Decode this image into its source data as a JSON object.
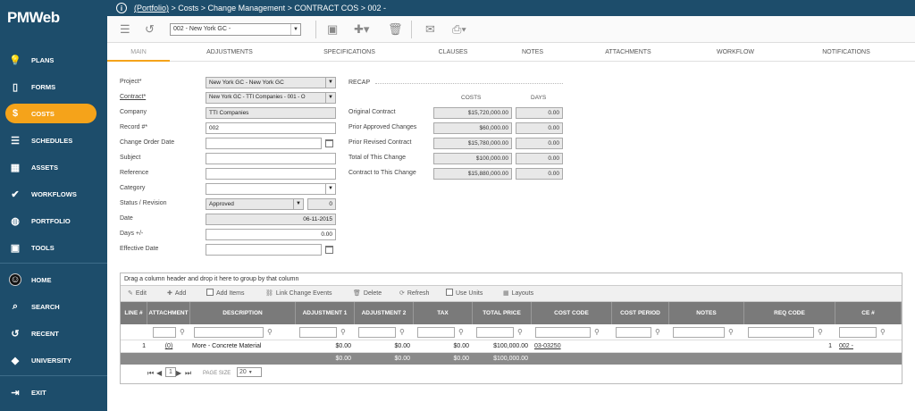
{
  "app": {
    "logo_text": "PMWeb"
  },
  "breadcrumb": {
    "root": "(Portfolio)",
    "rest": "> Costs > Change Management > CONTRACT COS > 002 -"
  },
  "toolbar": {
    "record_select_value": "002 - New York GC -"
  },
  "sidebar": {
    "items": [
      {
        "label": "PLANS",
        "icon": "lightbulb-icon"
      },
      {
        "label": "FORMS",
        "icon": "document-icon"
      },
      {
        "label": "COSTS",
        "icon": "dollar-icon"
      },
      {
        "label": "SCHEDULES",
        "icon": "schedule-icon"
      },
      {
        "label": "ASSETS",
        "icon": "building-icon"
      },
      {
        "label": "WORKFLOWS",
        "icon": "check-icon"
      },
      {
        "label": "PORTFOLIO",
        "icon": "globe-icon"
      },
      {
        "label": "TOOLS",
        "icon": "briefcase-icon"
      },
      {
        "label": "HOME",
        "icon": "avatar-icon"
      },
      {
        "label": "SEARCH",
        "icon": "search-icon"
      },
      {
        "label": "RECENT",
        "icon": "history-icon"
      },
      {
        "label": "UNIVERSITY",
        "icon": "graduation-cap-icon"
      },
      {
        "label": "EXIT",
        "icon": "exit-icon"
      }
    ]
  },
  "tabs": [
    "MAIN",
    "ADJUSTMENTS",
    "SPECIFICATIONS",
    "CLAUSES",
    "NOTES",
    "ATTACHMENTS",
    "WORKFLOW",
    "NOTIFICATIONS"
  ],
  "form": {
    "project": {
      "label": "Project*",
      "value": "New York GC - New York GC"
    },
    "contract": {
      "label": "Contract*",
      "value": "New York GC - TTI Companies - 001 - O"
    },
    "company": {
      "label": "Company",
      "value": "TTI Companies"
    },
    "record": {
      "label": "Record #*",
      "value": "002"
    },
    "change_order_date": {
      "label": "Change Order Date",
      "value": ""
    },
    "subject": {
      "label": "Subject",
      "value": ""
    },
    "reference": {
      "label": "Reference",
      "value": ""
    },
    "category": {
      "label": "Category",
      "value": ""
    },
    "status": {
      "label": "Status / Revision",
      "value": "Approved",
      "revision": "0"
    },
    "date": {
      "label": "Date",
      "value": "06-11-2015"
    },
    "days": {
      "label": "Days +/-",
      "value": "0.00"
    },
    "effective_date": {
      "label": "Effective Date",
      "value": ""
    }
  },
  "recap": {
    "title": "RECAP",
    "costs_header": "COSTS",
    "days_header": "DAYS",
    "rows": [
      {
        "label": "Original Contract",
        "cost": "$15,720,000.00",
        "days": "0.00"
      },
      {
        "label": "Prior Approved Changes",
        "cost": "$60,000.00",
        "days": "0.00"
      },
      {
        "label": "Prior Revised Contract",
        "cost": "$15,780,000.00",
        "days": "0.00"
      },
      {
        "label": "Total of This Change",
        "cost": "$100,000.00",
        "days": "0.00"
      },
      {
        "label": "Contract to This Change",
        "cost": "$15,880,000.00",
        "days": "0.00"
      }
    ]
  },
  "grid": {
    "group_hint": "Drag a column header and drop it here to group by that column",
    "toolbar": {
      "edit": "Edit",
      "add": "Add",
      "add_items": "Add Items",
      "link": "Link Change Events",
      "delete": "Delete",
      "refresh": "Refresh",
      "use_units": "Use Units",
      "layouts": "Layouts"
    },
    "columns": [
      "LINE #",
      "ATTACHMENT",
      "DESCRIPTION",
      "ADJUSTMENT 1",
      "ADJUSTMENT 2",
      "TAX",
      "TOTAL PRICE",
      "COST CODE",
      "COST PERIOD",
      "NOTES",
      "REQ CODE",
      "CE #"
    ],
    "row": {
      "line": "1",
      "attachment": "(0)",
      "description": "More - Concrete Material",
      "adj1": "$0.00",
      "adj2": "$0.00",
      "tax": "$0.00",
      "total": "$100,000.00",
      "cost_code": "03-03250",
      "cost_period": "",
      "notes": "",
      "req_code": "1",
      "ce": "002 -"
    },
    "totals": {
      "adj1": "$0.00",
      "adj2": "$0.00",
      "tax": "$0.00",
      "total": "$100,000.00"
    },
    "pager": {
      "current_page": "1",
      "page_size_label": "PAGE SIZE",
      "page_size": "20"
    }
  }
}
